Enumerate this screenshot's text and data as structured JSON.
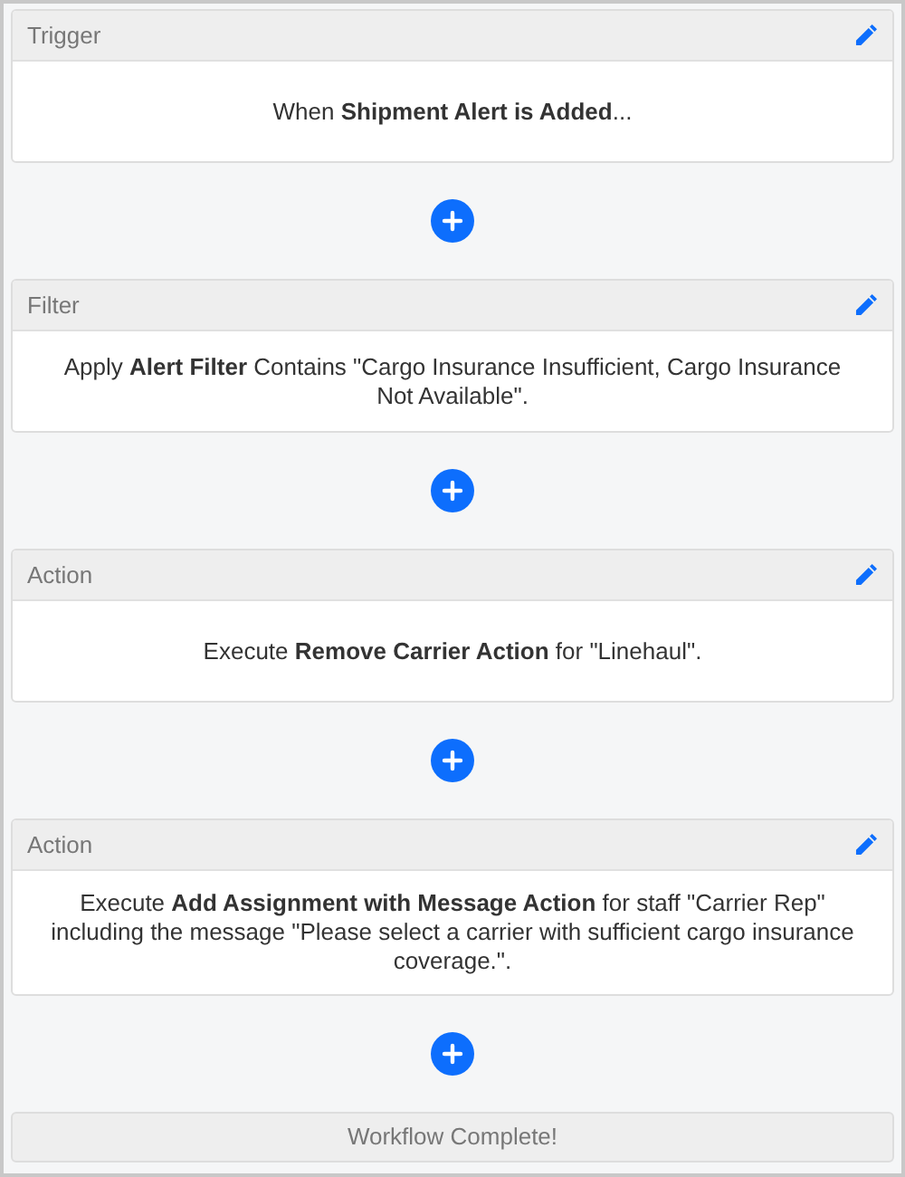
{
  "steps": [
    {
      "title": "Trigger",
      "text": "When **Shipment Alert is Added**..."
    },
    {
      "title": "Filter",
      "text": "Apply **Alert Filter** Contains \"Cargo Insurance Insufficient, Cargo Insurance Not Available\"."
    },
    {
      "title": "Action",
      "text": "Execute **Remove Carrier Action** for \"Linehaul\"."
    },
    {
      "title": "Action",
      "text": "Execute **Add Assignment with Message Action** for staff \"Carrier Rep\" including the message \"Please select a carrier with sufficient cargo insurance coverage.\"."
    }
  ],
  "footer": "Workflow Complete!"
}
